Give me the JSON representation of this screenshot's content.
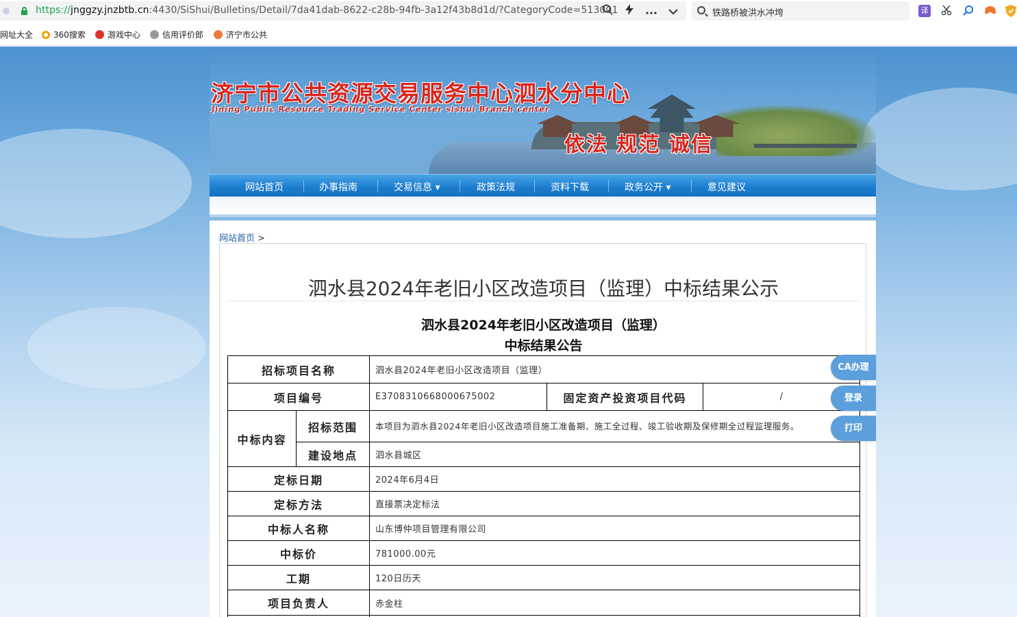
{
  "browser": {
    "url_scheme": "https://",
    "url_host": "jnggzy.jnzbtb.cn",
    "url_path": ":4430/SiShui/Bulletins/Detail/7da41dab-8622-c28b-94fb-3a12f43b8d1d/?CategoryCode=513001",
    "search_text": "铁路桥被洪水冲垮",
    "bookmarks": [
      "网址大全",
      "360搜索",
      "游戏中心",
      "信用评价郎",
      "济宁市公共"
    ],
    "ext_translate_label": "译",
    "colors": {
      "secure": "#1fa34a"
    }
  },
  "site": {
    "title": "济宁市公共资源交易服务中心泗水分中心",
    "subtitle": "Jining Public Resource Trading Service Center sishui Branch center",
    "slogan": "依法 规范 诚信"
  },
  "nav": {
    "items": [
      "网站首页",
      "办事指南",
      "交易信息 ▾",
      "政策法规",
      "资料下载",
      "政务公开 ▾",
      "意见建议"
    ]
  },
  "breadcrumb": {
    "home": "网站首页",
    "separator": ">"
  },
  "notice": {
    "title": "泗水县2024年老旧小区改造项目（监理）中标结果公示",
    "heading_line1": "泗水县2024年老旧小区改造项目（监理）",
    "heading_line2": "中标结果公告"
  },
  "table": {
    "project_name_label": "招标项目名称",
    "project_name": "泗水县2024年老旧小区改造项目（监理）",
    "project_no_label": "项目编号",
    "project_no": "E3708310668000675002",
    "fixed_asset_label": "固定资产投资项目代码",
    "fixed_asset_code": "/",
    "content_label": "中标内容",
    "scope_label": "招标范围",
    "scope": "本项目为泗水县2024年老旧小区改造项目施工准备期、施工全过程、竣工验收期及保修期全过程监理服务。",
    "site_label": "建设地点",
    "site": "泗水县城区",
    "date_label": "定标日期",
    "date": "2024年6月4日",
    "method_label": "定标方法",
    "method": "直接票决定标法",
    "winner_label": "中标人名称",
    "winner": "山东博仲项目管理有限公司",
    "price_label": "中标价",
    "price": "781000.00元",
    "period_label": "工期",
    "period": "120日历天",
    "manager_label": "项目负责人",
    "manager": "赤金柱"
  },
  "float_buttons": {
    "ca": "CA办理",
    "login": "登录",
    "print": "打印"
  }
}
